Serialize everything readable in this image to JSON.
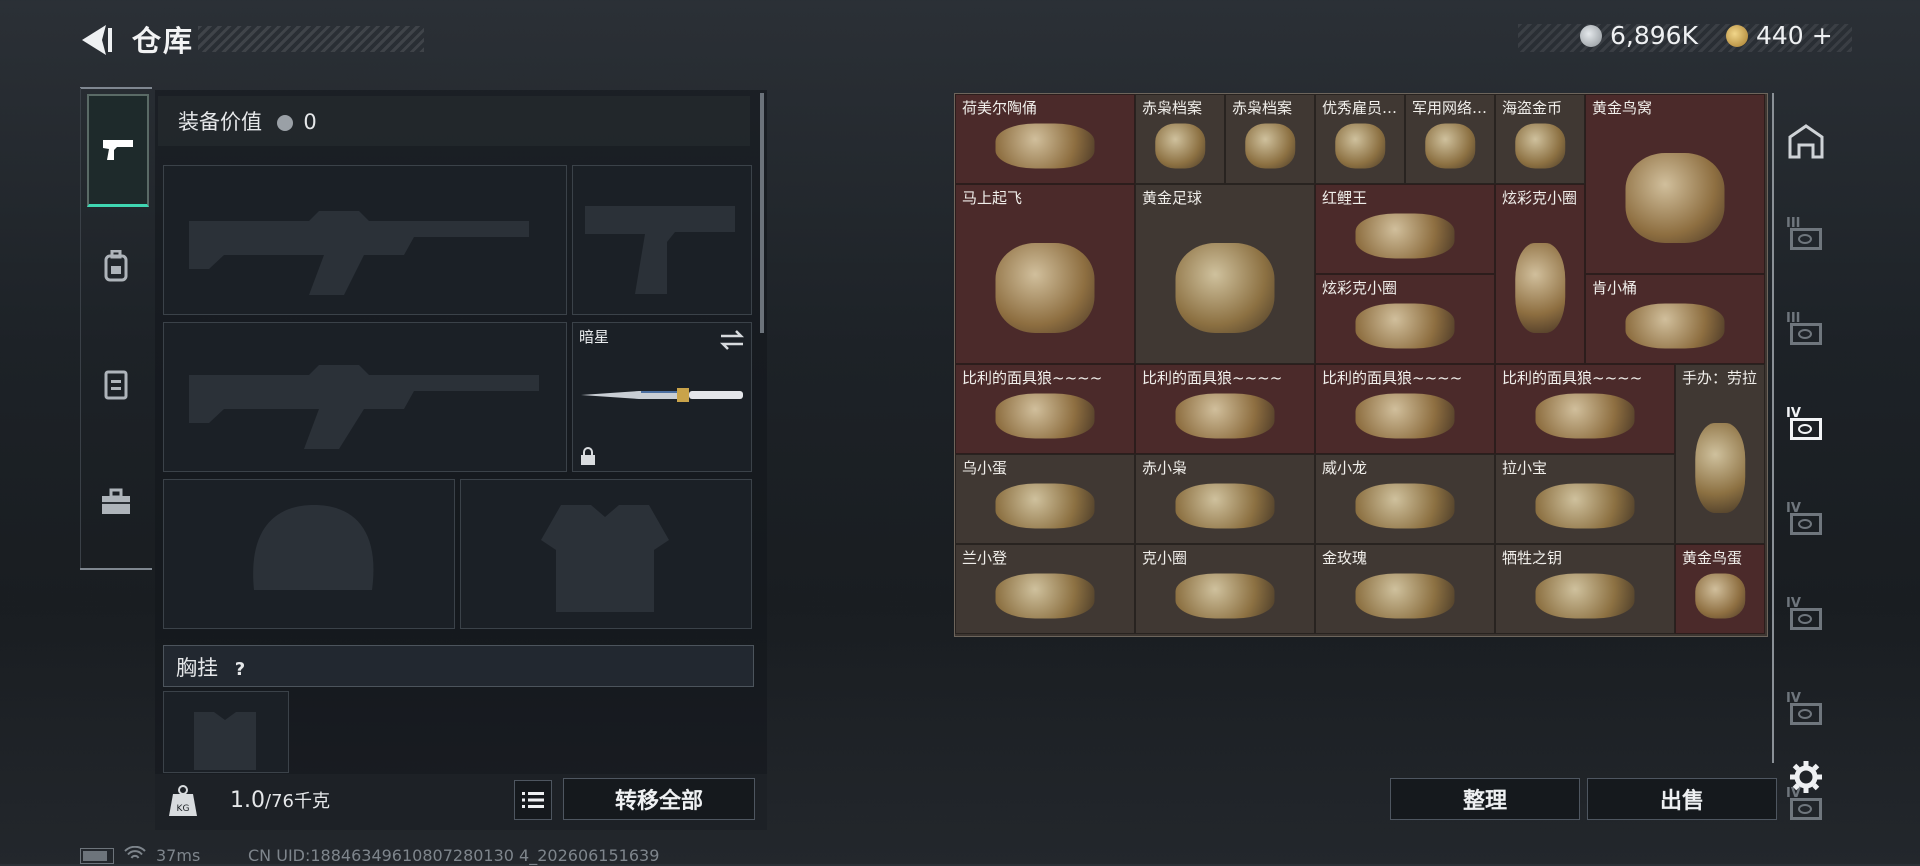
{
  "header": {
    "title": "仓库",
    "currency_coins": "6,896K",
    "currency_tokens": "440",
    "currency_add": "+"
  },
  "equipment": {
    "value_label": "装备价值",
    "value": "0",
    "melee_name": "暗星",
    "chest_label": "胸挂",
    "chest_help": "?",
    "weight_current": "1.0",
    "weight_max": "/76千克",
    "weight_icon_text": "KG",
    "transfer_all": "转移全部"
  },
  "inventory": {
    "items": [
      {
        "label": "荷美尔陶俑",
        "color": "red"
      },
      {
        "label": "赤枭档案",
        "color": "brown"
      },
      {
        "label": "赤枭档案",
        "color": "brown"
      },
      {
        "label": "优秀雇员…",
        "color": "brown"
      },
      {
        "label": "军用网络…",
        "color": "brown"
      },
      {
        "label": "海盗金币",
        "color": "brown"
      },
      {
        "label": "黄金鸟窝",
        "color": "red"
      },
      {
        "label": "马上起飞",
        "color": "red"
      },
      {
        "label": "黄金足球",
        "color": "brown"
      },
      {
        "label": "红鲤王",
        "color": "red"
      },
      {
        "label": "炫彩克小圈",
        "color": "red"
      },
      {
        "label": "炫彩克小圈",
        "color": "red"
      },
      {
        "label": "肯小桶",
        "color": "red"
      },
      {
        "label": "比利的面具狼~~~~",
        "color": "red"
      },
      {
        "label": "比利的面具狼~~~~",
        "color": "red"
      },
      {
        "label": "比利的面具狼~~~~",
        "color": "red"
      },
      {
        "label": "比利的面具狼~~~~",
        "color": "red"
      },
      {
        "label": "手办：劳拉",
        "color": "brown"
      },
      {
        "label": "乌小蛋",
        "color": "brown"
      },
      {
        "label": "赤小枭",
        "color": "brown"
      },
      {
        "label": "威小龙",
        "color": "brown"
      },
      {
        "label": "拉小宝",
        "color": "brown"
      },
      {
        "label": "兰小登",
        "color": "brown"
      },
      {
        "label": "克小圈",
        "color": "brown"
      },
      {
        "label": "金玫瑰",
        "color": "brown"
      },
      {
        "label": "牺牲之钥",
        "color": "brown"
      },
      {
        "label": "黄金鸟蛋",
        "color": "red"
      }
    ],
    "sort_button": "整理",
    "sell_button": "出售"
  },
  "side_tabs": [
    "III",
    "III",
    "IV",
    "IV",
    "IV",
    "IV",
    "IV"
  ],
  "status_bar": {
    "ping": "37ms",
    "uid": "CN UID:18846349610807280130 4_202606151639"
  },
  "colors": {
    "accent_teal": "#3fd6b2",
    "rare_red": "#4b2a2a",
    "common_brown": "#403833"
  }
}
